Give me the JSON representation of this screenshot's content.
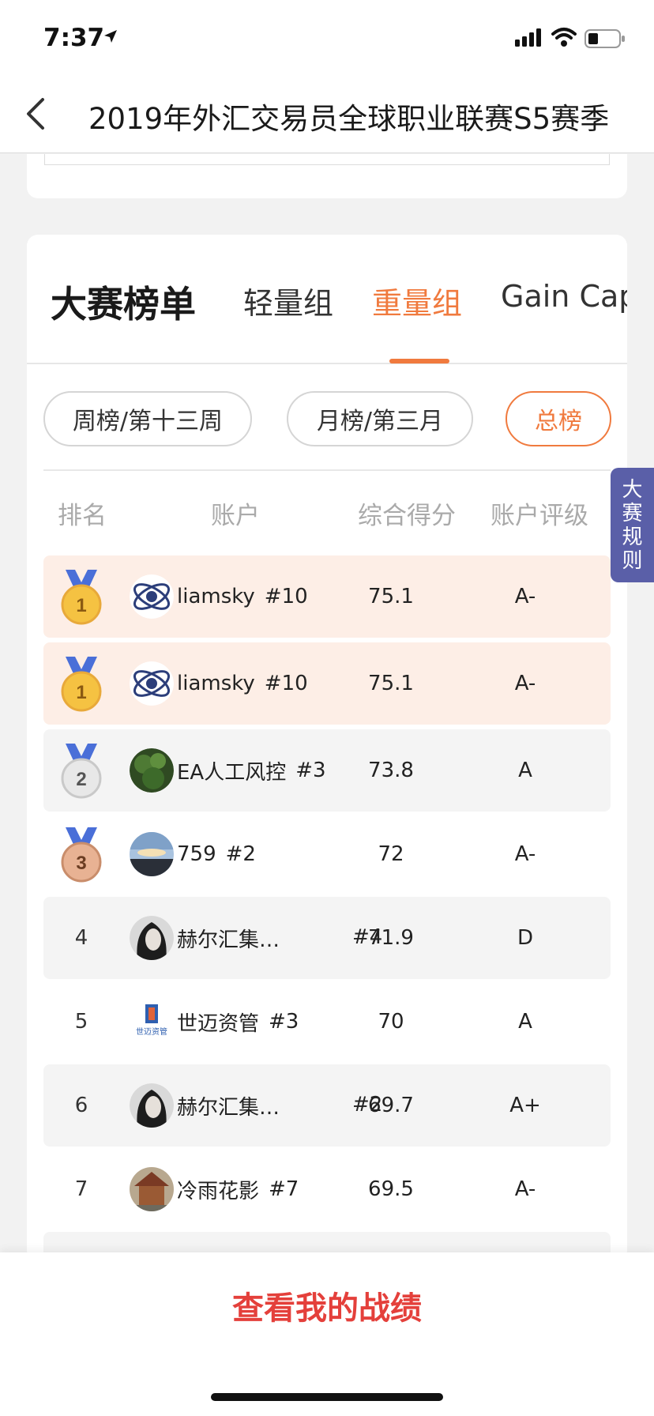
{
  "status_bar": {
    "time": "7:37"
  },
  "nav": {
    "title": "2019年外汇交易员全球职业联赛S5赛季"
  },
  "board": {
    "title": "大赛榜单",
    "tabs": [
      {
        "label": "轻量组",
        "active": false
      },
      {
        "label": "重量组",
        "active": true
      },
      {
        "label": "Gain Cap",
        "active": false
      }
    ],
    "periods": [
      {
        "label": "周榜/第十三周",
        "active": false
      },
      {
        "label": "月榜/第三月",
        "active": false
      },
      {
        "label": "总榜",
        "active": true
      }
    ],
    "columns": [
      "排名",
      "账户",
      "综合得分",
      "账户评级"
    ],
    "rows": [
      {
        "rank": "1",
        "medal": "gold",
        "avatar": "liamsky-avatar",
        "name": "liamsky",
        "id": "#10",
        "score": "75.1",
        "grade": "A-"
      },
      {
        "rank": "1",
        "medal": "gold",
        "avatar": "liamsky-avatar",
        "name": "liamsky",
        "id": "#10",
        "score": "75.1",
        "grade": "A-"
      },
      {
        "rank": "2",
        "medal": "silver",
        "avatar": "tree-avatar",
        "name": "EA人工风控",
        "id": "#3",
        "score": "73.8",
        "grade": "A"
      },
      {
        "rank": "3",
        "medal": "bronze",
        "avatar": "sunset-avatar",
        "name": "759",
        "id": "#2",
        "score": "72",
        "grade": "A-"
      },
      {
        "rank": "4",
        "medal": "",
        "avatar": "portrait-avatar",
        "name": "赫尔汇集…",
        "id": "#4",
        "score": "71.9",
        "grade": "D"
      },
      {
        "rank": "5",
        "medal": "",
        "avatar": "shimai-logo",
        "name": "世迈资管",
        "id": "#3",
        "score": "70",
        "grade": "A"
      },
      {
        "rank": "6",
        "medal": "",
        "avatar": "portrait-avatar",
        "name": "赫尔汇集…",
        "id": "#2",
        "score": "69.7",
        "grade": "A+"
      },
      {
        "rank": "7",
        "medal": "",
        "avatar": "temple-avatar",
        "name": "冷雨花影",
        "id": "#7",
        "score": "69.5",
        "grade": "A-"
      }
    ],
    "logo_text": "世迈资管"
  },
  "side_tab": {
    "label": [
      "大",
      "赛",
      "规",
      "则"
    ]
  },
  "footer": {
    "action": "查看我的战绩"
  },
  "colors": {
    "accent": "#f07a3e",
    "danger": "#e4403b",
    "side_tab": "#5a5fa8"
  }
}
